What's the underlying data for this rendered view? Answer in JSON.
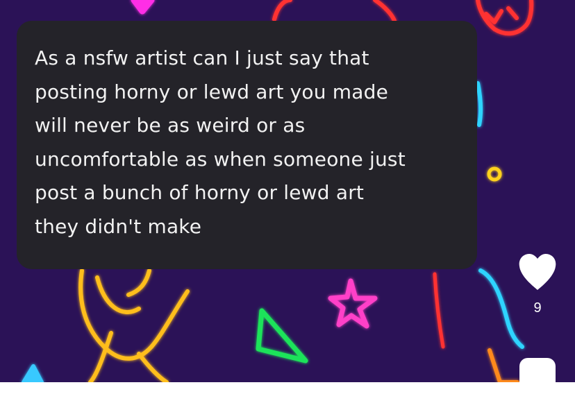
{
  "post": {
    "text": "As a nsfw artist can I just say that\nposting horny or lewd art you made\nwill never be as weird or as\nuncomfortable as when someone just\npost a bunch of horny or lewd art\nthey didn't make"
  },
  "like": {
    "count": "9",
    "icon": "heart-icon",
    "color": "#ffffff"
  },
  "theme": {
    "background": "#2b1257",
    "card": "#242329",
    "text": "#f2f2f2"
  }
}
